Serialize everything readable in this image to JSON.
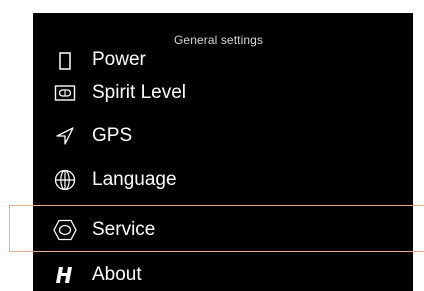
{
  "header": {
    "title": "General settings"
  },
  "menu": {
    "items": [
      {
        "label": "Power",
        "icon": "power-icon"
      },
      {
        "label": "Spirit Level",
        "icon": "spirit-level-icon"
      },
      {
        "label": "GPS",
        "icon": "gps-icon"
      },
      {
        "label": "Language",
        "icon": "globe-icon"
      },
      {
        "label": "Service",
        "icon": "hexagon-nut-icon",
        "selected": true
      },
      {
        "label": "About",
        "icon": "hasselblad-h-icon"
      }
    ]
  },
  "colors": {
    "background": "#000000",
    "text": "#ffffff",
    "highlight_border": "#e8a98a"
  }
}
